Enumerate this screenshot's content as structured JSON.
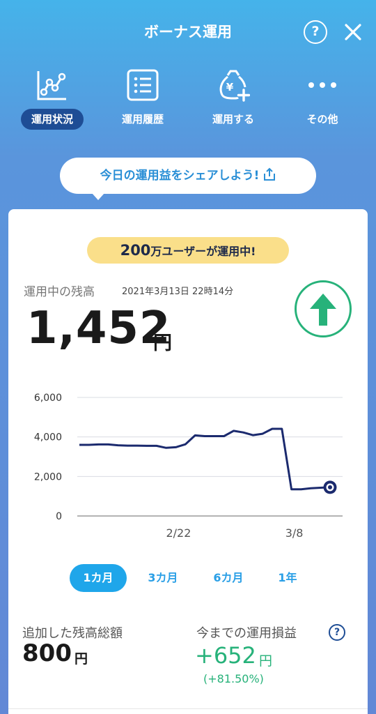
{
  "header": {
    "title": "ボーナス運用",
    "help_label": "?"
  },
  "nav": {
    "items": [
      {
        "label": "運用状況",
        "icon": "line-chart-icon",
        "active": true
      },
      {
        "label": "運用履歴",
        "icon": "list-icon",
        "active": false
      },
      {
        "label": "運用する",
        "icon": "money-bag-plus-icon",
        "active": false
      },
      {
        "label": "その他",
        "icon": "more-dots-icon",
        "active": false
      }
    ]
  },
  "share": {
    "label": "今日の運用益をシェアしよう!"
  },
  "card": {
    "badge_count": "200",
    "badge_text": "万ユーザーが運用中!",
    "balance_label": "運用中の残高",
    "timestamp": "2021年3月13日 22時14分",
    "balance_value": "1,452",
    "balance_unit": "円",
    "trend": "up",
    "added_label": "追加した残高総額",
    "added_value": "800",
    "added_unit": "円",
    "pl_label": "今までの運用損益",
    "pl_help": "?",
    "pl_value": "+652",
    "pl_unit": "円",
    "pl_pct": "(+81.50%)"
  },
  "periods": [
    {
      "label": "1カ月",
      "active": true
    },
    {
      "label": "3カ月",
      "active": false
    },
    {
      "label": "6カ月",
      "active": false
    },
    {
      "label": "1年",
      "active": false
    }
  ],
  "colors": {
    "accent": "#1fa6ea",
    "nav_active": "#1e4d95",
    "positive": "#27b27a",
    "line": "#1b2a6e",
    "badge": "#fadf8a"
  },
  "chart_data": {
    "type": "line",
    "y_ticks": [
      "6,000",
      "4,000",
      "2,000",
      "0"
    ],
    "ylim": [
      0,
      6000
    ],
    "x_ticks": [
      "2/22",
      "3/8"
    ],
    "xlabel": "",
    "ylabel": "",
    "grid": true,
    "series": [
      {
        "values": [
          3600,
          3600,
          3620,
          3620,
          3580,
          3560,
          3560,
          3550,
          3550,
          3450,
          3480,
          3630,
          4080,
          4040,
          4040,
          4040,
          4310,
          4230,
          4090,
          4160,
          4410,
          4410,
          1350,
          1350,
          1400,
          1430,
          1452
        ]
      }
    ]
  }
}
